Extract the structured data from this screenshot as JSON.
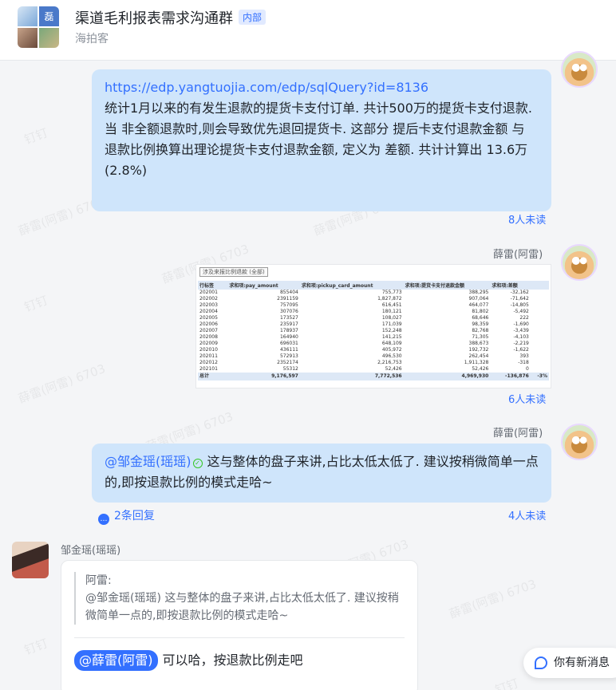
{
  "header": {
    "title": "渠道毛利报表需求沟通群",
    "badge": "内部",
    "subtitle": "海拍客",
    "avatar_tile": "磊"
  },
  "watermark": {
    "text": "薛雷(阿雷) 6703",
    "stamp": "钉钉"
  },
  "messages": [
    {
      "link": "https://edp.yangtuojia.com/edp/sqlQuery?id=8136",
      "text": "统计1月以来的有发生退款的提货卡支付订单. 共计500万的提货卡支付退款.\n当 非全额退款时,则会导致优先退回提货卡. 这部分 提后卡支付退款金额 与 退款比例换算出理论提货卡支付退款金额, 定义为 差额. 共计计算出 13.6万(2.8%)",
      "read_status": "8人未读"
    },
    {
      "sender": "薛雷(阿雷)",
      "read_status": "6人未读"
    },
    {
      "sender": "薛雷(阿雷)",
      "mention": "@邹金瑶(瑶瑶)",
      "text": "这与整体的盘子来讲,占比太低太低了. 建议按稍微简单一点的,即按退款比例的模式走哈~",
      "replies": "2条回复",
      "read_status": "4人未读"
    }
  ],
  "pivot": {
    "filter": "涉及来报比例退款  (全部)",
    "headers": [
      "行标签",
      "求和项:pay_amount",
      "求和项:pickup_card_amount",
      "求和项:提货卡支付退款金额",
      "求和项:差额"
    ],
    "rows": [
      [
        "202001",
        "855404",
        "755,773",
        "388,295",
        "-32,162"
      ],
      [
        "202002",
        "2391159",
        "1,827,872",
        "907,064",
        "-71,642"
      ],
      [
        "202003",
        "757095",
        "616,451",
        "464,077",
        "-14,805"
      ],
      [
        "202004",
        "307076",
        "180,121",
        "81,802",
        "-5,492"
      ],
      [
        "202005",
        "173527",
        "108,027",
        "68,646",
        "222"
      ],
      [
        "202006",
        "235917",
        "171,039",
        "98,359",
        "-1,690"
      ],
      [
        "202007",
        "178937",
        "152,248",
        "82,768",
        "-3,439"
      ],
      [
        "202008",
        "164940",
        "141,215",
        "71,305",
        "-4,103"
      ],
      [
        "202009",
        "696031",
        "648,109",
        "388,673",
        "-2,219"
      ],
      [
        "202010",
        "436111",
        "405,972",
        "192,732",
        "-1,622"
      ],
      [
        "202011",
        "572913",
        "496,530",
        "262,454",
        "393"
      ],
      [
        "202012",
        "2352174",
        "2,216,753",
        "1,911,328",
        "-318"
      ],
      [
        "202101",
        "55312",
        "52,426",
        "52,426",
        "0"
      ]
    ],
    "total": [
      "总计",
      "9,176,597",
      "7,772,536",
      "4,969,930",
      "-136,876"
    ],
    "side_note": "-3%"
  },
  "reply": {
    "sender": "邹金瑶(瑶瑶)",
    "quote_author": "阿雷:",
    "quote_text": "@邹金瑶(瑶瑶) 这与整体的盘子来讲,占比太低太低了. 建议按稍微简单一点的,即按退款比例的模式走哈~",
    "mention": "@薛雷(阿雷)",
    "text": "可以哈，按退款比例走吧"
  },
  "new_message_button": "你有新消息"
}
